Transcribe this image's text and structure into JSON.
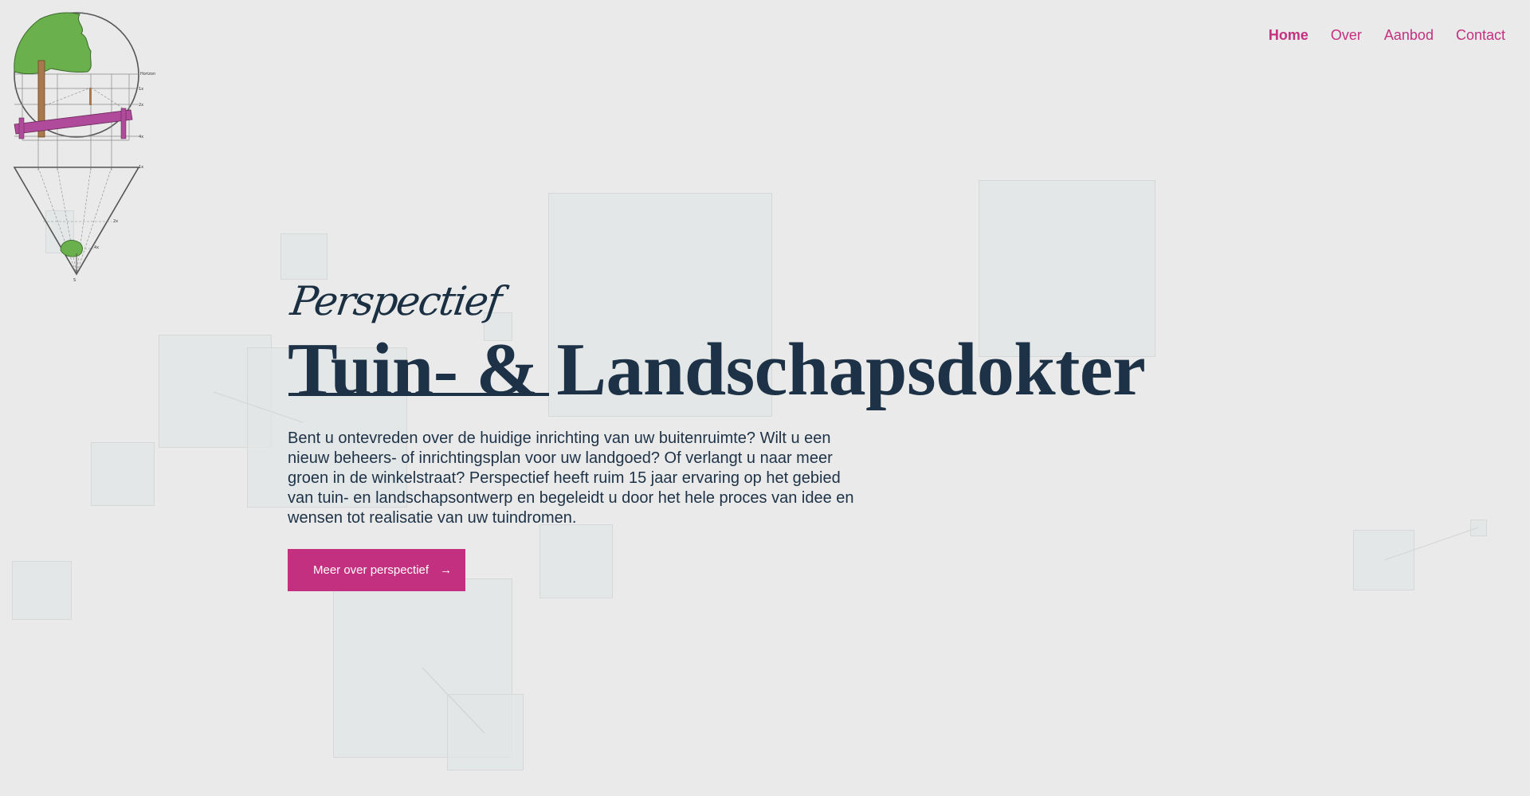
{
  "nav": {
    "items": [
      {
        "label": "Home",
        "active": true
      },
      {
        "label": "Over",
        "active": false
      },
      {
        "label": "Aanbod",
        "active": false
      },
      {
        "label": "Contact",
        "active": false
      }
    ]
  },
  "logo": {
    "icon": "perspective-tree-logo",
    "labels": [
      "Horizon",
      "1x",
      "2x",
      "4x",
      "1x",
      "2x",
      "4x",
      "S"
    ]
  },
  "hero": {
    "eyebrow": "Perspectief",
    "title": "Tuin- & Landschapsdokter",
    "lead": "Bent u ontevreden over de huidige inrichting van uw buitenruimte? Wilt u een nieuw beheers- of inrichtingsplan voor uw landgoed? Of verlangt u naar meer groen in de winkelstraat? Perspectief heeft ruim 15 jaar ervaring op het gebied van tuin- en landschapsontwerp en begeleidt u door het hele proces van idee en wensen tot realisatie van uw tuindromen.",
    "cta_label": "Meer over perspectief",
    "cta_icon": "arrow-right-icon"
  },
  "colors": {
    "background": "#eaeaea",
    "accent": "#c3307f",
    "text": "#1d3246",
    "tree_green": "#6ab04c",
    "bench_pink": "#b04a9a"
  }
}
